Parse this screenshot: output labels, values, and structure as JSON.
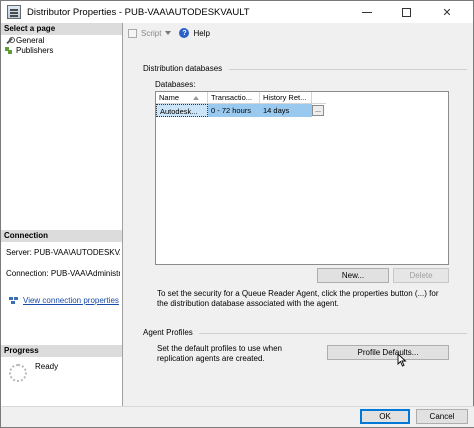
{
  "window": {
    "title": "Distributor Properties - PUB-VAA\\AUTODESKVAULT"
  },
  "left_pane": {
    "select_page_header": "Select a page",
    "pages": [
      {
        "label": "General",
        "icon": "wrench-icon"
      },
      {
        "label": "Publishers",
        "icon": "publishers-icon"
      }
    ],
    "connection_header": "Connection",
    "server_text": "Server: PUB-VAA\\AUTODESKVAULT",
    "connection_text": "Connection: PUB-VAA\\Administrator",
    "view_connection_link": "View connection properties",
    "progress_header": "Progress",
    "progress_status": "Ready"
  },
  "toolbar": {
    "script_label": "Script",
    "help_label": "Help"
  },
  "distribution": {
    "group_label": "Distribution databases",
    "databases_label": "Databases:",
    "columns": [
      "Name",
      "Transactio...",
      "History Ret..."
    ],
    "rows": [
      {
        "name": "Autodesk...",
        "transaction": "0 - 72 hours",
        "history": "14 days",
        "button": "..."
      }
    ],
    "new_button": "New...",
    "delete_button": "Delete",
    "info_text": "To set the security for a Queue Reader Agent, click the properties button (...) for the distribution database associated with the agent."
  },
  "agent_profiles": {
    "group_label": "Agent Profiles",
    "info_text": "Set the default profiles to use when replication agents are created.",
    "profile_defaults_button": "Profile Defaults..."
  },
  "footer": {
    "ok_button": "OK",
    "cancel_button": "Cancel"
  }
}
